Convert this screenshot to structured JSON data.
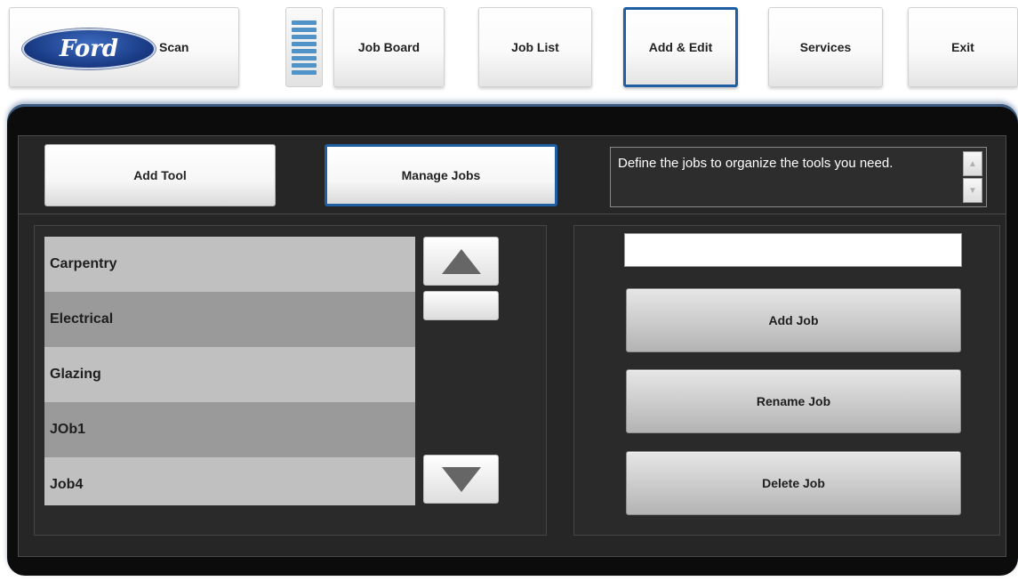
{
  "toolbar": {
    "logo_text": "Ford",
    "scan_label": "Scan",
    "job_board_label": "Job Board",
    "job_list_label": "Job List",
    "add_edit_label": "Add & Edit",
    "services_label": "Services",
    "exit_label": "Exit",
    "active_tab": "Add & Edit"
  },
  "modes": {
    "add_tool_label": "Add Tool",
    "manage_jobs_label": "Manage Jobs",
    "active_mode": "Manage Jobs"
  },
  "description": "Define the jobs to organize the tools you need.",
  "jobs": [
    {
      "name": "Carpentry"
    },
    {
      "name": "Electrical"
    },
    {
      "name": "Glazing"
    },
    {
      "name": "JOb1"
    },
    {
      "name": "Job4"
    }
  ],
  "job_name_input": {
    "value": "",
    "placeholder": ""
  },
  "actions": {
    "add_job_label": "Add Job",
    "rename_job_label": "Rename Job",
    "delete_job_label": "Delete Job"
  },
  "icons": {
    "scroll_up": "triangle-up-icon",
    "scroll_down": "triangle-down-icon",
    "menu": "menu-bars-icon"
  },
  "colors": {
    "accent_border": "#1f5ea3",
    "panel_background": "#262626",
    "row_light": "#c0c0c0",
    "row_dark": "#9a9a9a"
  }
}
